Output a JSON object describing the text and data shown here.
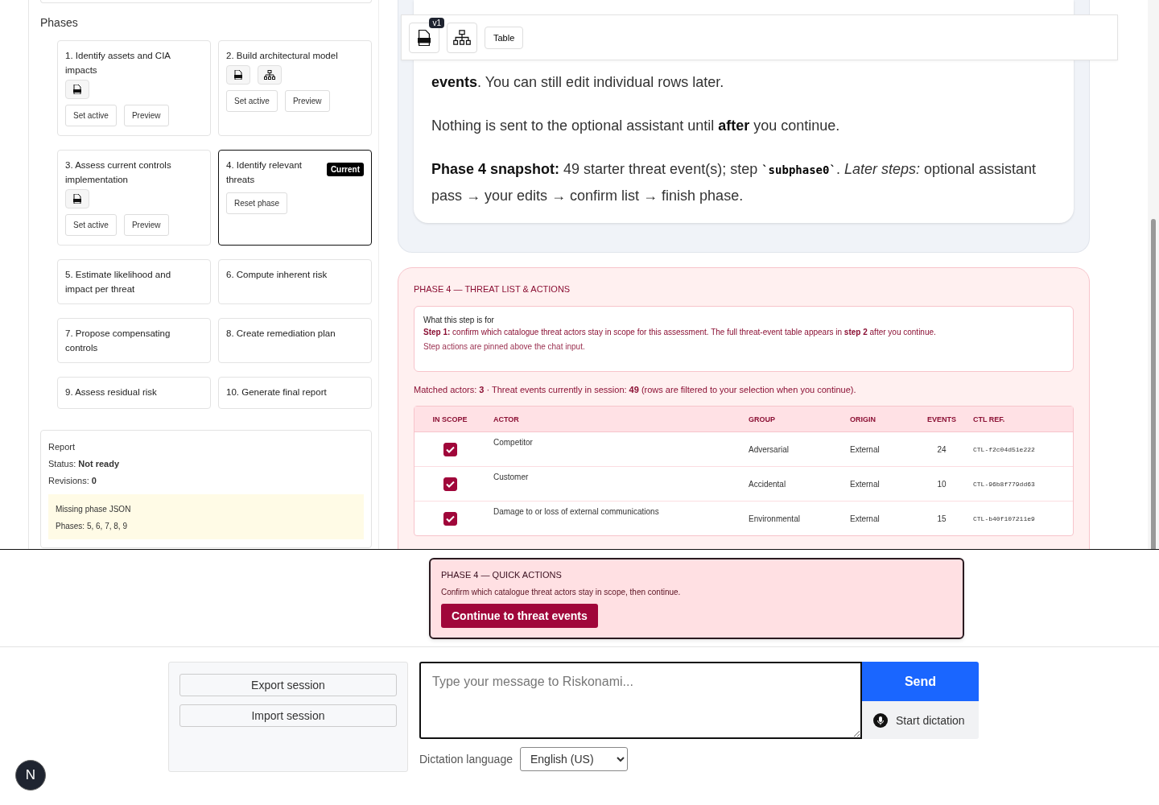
{
  "sidebar": {
    "heading": "Phases",
    "phases": [
      {
        "title": "1. Identify assets and CIA impacts",
        "current": false,
        "icons": [
          {
            "kind": "json"
          }
        ],
        "buttons": [
          "Set active",
          "Preview"
        ]
      },
      {
        "title": "2. Build architectural model",
        "current": false,
        "icons": [
          {
            "kind": "json"
          },
          {
            "kind": "diagram"
          }
        ],
        "buttons": [
          "Set active",
          "Preview"
        ]
      },
      {
        "title": "3. Assess current controls implementation",
        "current": false,
        "icons": [
          {
            "kind": "json"
          }
        ],
        "buttons": [
          "Set active",
          "Preview"
        ]
      },
      {
        "title": "4. Identify relevant threats",
        "current": true,
        "badge": "Current",
        "buttons": [
          "Reset phase"
        ]
      },
      {
        "title": "5. Estimate likelihood and impact per threat",
        "current": false
      },
      {
        "title": "6. Compute inherent risk",
        "current": false
      },
      {
        "title": "7. Propose compensating controls",
        "current": false
      },
      {
        "title": "8. Create remediation plan",
        "current": false
      },
      {
        "title": "9. Assess residual risk",
        "current": false
      },
      {
        "title": "10. Generate final report",
        "current": false
      }
    ],
    "report": {
      "title": "Report",
      "status": "Status: **Not ready**",
      "revisions": "Revisions: **0**",
      "warning_title": "Missing phase JSON",
      "warning_detail": "Phases: 5, 6, 7, 8, 9"
    }
  },
  "message": {
    "toolbar": {
      "badge": "v1",
      "table_button": "Table"
    },
    "paragraphs": [
      "**events**. You can still edit individual rows later.",
      "Nothing is sent to the optional assistant until **after** you continue.",
      "**Phase 4 snapshot:** 49 starter threat event(s); step `subphase0`. *Later steps:* optional assistant pass → your edits → confirm list → finish phase."
    ]
  },
  "threat_panel": {
    "title": "PHASE 4 — THREAT LIST & ACTIONS",
    "info": {
      "title": "What this step is for",
      "text": "**Step 1:** confirm which catalogue threat actors stay in scope for this assessment. The full threat-event table appears in **step 2** after you continue.",
      "note": "Step actions are pinned above the chat input."
    },
    "summary": "Matched actors: **3** · Threat events currently in session: **49** (rows are filtered to your selection when you continue).",
    "columns": [
      "IN SCOPE",
      "ACTOR",
      "GROUP",
      "ORIGIN",
      "EVENTS",
      "CTL REF."
    ],
    "rows": [
      {
        "checked": true,
        "actor": "Competitor",
        "group": "Adversarial",
        "origin": "External",
        "events": "24",
        "ctl_ref": "CTL-f2c04d51e222"
      },
      {
        "checked": true,
        "actor": "Customer",
        "group": "Accidental",
        "origin": "External",
        "events": "10",
        "ctl_ref": "CTL-96b8f779dd63"
      },
      {
        "checked": true,
        "actor": "Damage to or loss of external communications",
        "group": "Environmental",
        "origin": "External",
        "events": "15",
        "ctl_ref": "CTL-b40f107211e9"
      }
    ]
  },
  "quick_actions": {
    "title": "PHASE 4 — QUICK ACTIONS",
    "text": "Confirm which catalogue threat actors stay in scope, then continue.",
    "button": "Continue to threat events"
  },
  "session": {
    "buttons": [
      "Export session",
      "Import session"
    ]
  },
  "chat": {
    "placeholder": "Type your message to Riskonami...",
    "send": "Send",
    "dictation": "Start dictation",
    "language_label": "Dictation language",
    "language": "English (US)"
  },
  "avatar": {
    "letter": "N"
  }
}
